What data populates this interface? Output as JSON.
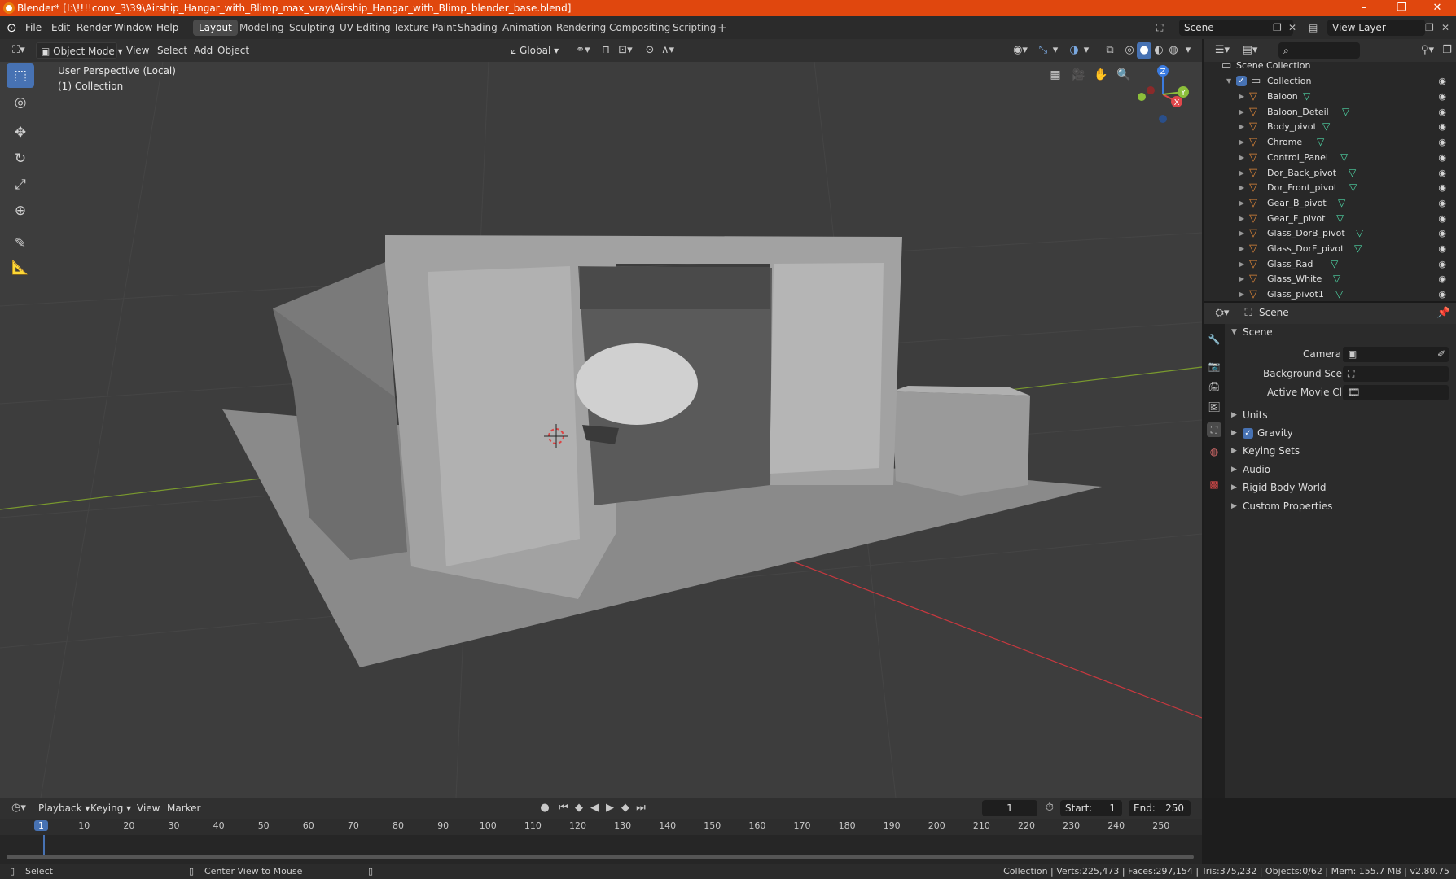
{
  "window": {
    "title": "Blender* [I:\\!!!!conv_3\\39\\Airship_Hangar_with_Blimp_max_vray\\Airship_Hangar_with_Blimp_blender_base.blend]",
    "minimize": "–",
    "maximize": "❐",
    "close": "✕"
  },
  "menu": {
    "file": "File",
    "edit": "Edit",
    "render": "Render",
    "window": "Window",
    "help": "Help"
  },
  "workspaces": [
    "Layout",
    "Modeling",
    "Sculpting",
    "UV Editing",
    "Texture Paint",
    "Shading",
    "Animation",
    "Rendering",
    "Compositing",
    "Scripting"
  ],
  "scene_field": "Scene",
  "view_layer_field": "View Layer",
  "viewport_header": {
    "mode": "Object Mode",
    "view": "View",
    "select": "Select",
    "add": "Add",
    "object": "Object",
    "orientation": "Global"
  },
  "viewport": {
    "perspective": "User Perspective (Local)",
    "collection": "(1) Collection"
  },
  "gizmo": {
    "x": "X",
    "y": "Y",
    "z": "Z"
  },
  "outliner": {
    "root": "Scene Collection",
    "collection": "Collection",
    "items": [
      "Baloon",
      "Baloon_Deteil",
      "Body_pivot",
      "Chrome",
      "Control_Panel",
      "Dor_Back_pivot",
      "Dor_Front_pivot",
      "Gear_B_pivot",
      "Gear_F_pivot",
      "Glass_DorB_pivot",
      "Glass_DorF_pivot",
      "Glass_Rad",
      "Glass_White",
      "Glass_pivot1"
    ]
  },
  "properties": {
    "context": "Scene",
    "section": "Scene",
    "camera_label": "Camera",
    "background_label": "Background Scene",
    "movieclip_label": "Active Movie Clip",
    "panels": [
      "Units",
      "Gravity",
      "Keying Sets",
      "Audio",
      "Rigid Body World",
      "Custom Properties"
    ]
  },
  "timeline": {
    "playback": "Playback",
    "keying": "Keying",
    "view": "View",
    "marker": "Marker",
    "current_frame": "1",
    "start_label": "Start:",
    "start": "1",
    "end_label": "End:",
    "end": "250",
    "ticks": [
      "1",
      "10",
      "20",
      "30",
      "40",
      "50",
      "60",
      "70",
      "80",
      "90",
      "100",
      "110",
      "120",
      "130",
      "140",
      "150",
      "160",
      "170",
      "180",
      "190",
      "200",
      "210",
      "220",
      "230",
      "240",
      "250"
    ]
  },
  "status": {
    "select": "Select",
    "center": "Center View to Mouse",
    "stats": "Collection | Verts:225,473 | Faces:297,154 | Tris:375,232 | Objects:0/62 | Mem: 155.7 MB | v2.80.75"
  },
  "colors": {
    "titlebar": "#e0470e",
    "accent": "#4772b3",
    "viewport": "#3d3d3d",
    "x_axis": "#c8383f",
    "y_axis": "#7a9a2e"
  }
}
